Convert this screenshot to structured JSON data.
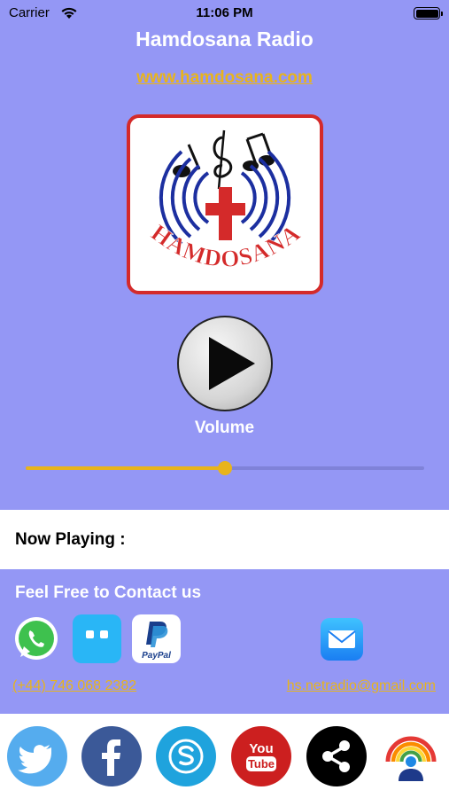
{
  "status_bar": {
    "carrier": "Carrier",
    "time": "11:06 PM"
  },
  "app": {
    "title": "Hamdosana Radio",
    "website": "www.hamdosana.com"
  },
  "logo": {
    "text": "HAMDOSANA",
    "icon": "hamdosana-logo"
  },
  "player": {
    "play_icon": "play-icon",
    "volume_label": "Volume",
    "volume_level": 0.5
  },
  "now_playing": {
    "label": "Now Playing :"
  },
  "contact": {
    "title": "Feel Free to Contact us",
    "phone": "(+44) 746 068 2382",
    "email": "hs.netradio@gmail.com",
    "icons": [
      "whatsapp-icon",
      "messenger-icon",
      "paypal-icon",
      "mail-icon"
    ],
    "paypal_text": "PayPal"
  },
  "social": {
    "icons": [
      "twitter-icon",
      "facebook-icon",
      "skype-icon",
      "youtube-icon",
      "share-icon",
      "radio-icon"
    ],
    "youtube_text": [
      "You",
      "Tube"
    ]
  },
  "colors": {
    "background": "#9497f5",
    "accent": "#e8b41c",
    "logo_border": "#d42a2a"
  }
}
